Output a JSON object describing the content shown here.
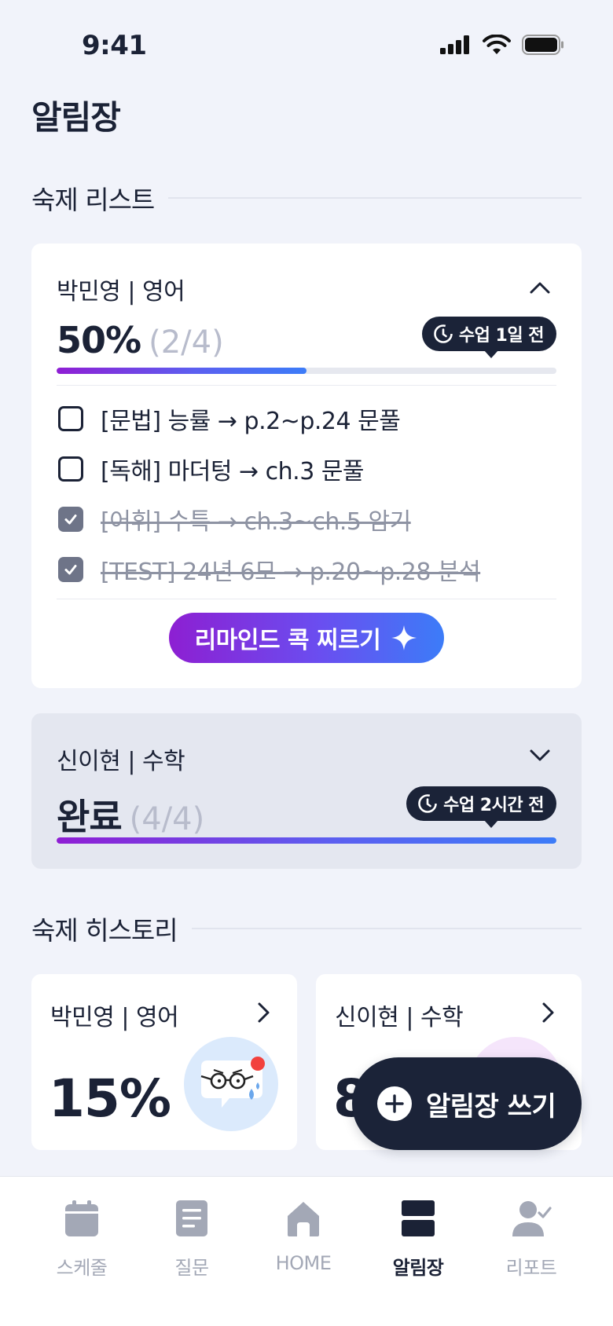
{
  "status_bar": {
    "time": "9:41"
  },
  "page_title": "알림장",
  "homework_list": {
    "section_label": "숙제 리스트",
    "cards": [
      {
        "title": "박민영 | 영어",
        "progress_main": "50%",
        "progress_sub": "(2/4)",
        "progress_fraction": 0.5,
        "tooltip": "수업 1일 전",
        "expanded": true,
        "tasks": [
          {
            "text": "[문법] 능률 → p.2~p.24 문풀",
            "done": false
          },
          {
            "text": "[독해] 마더텅 → ch.3 문풀",
            "done": false
          },
          {
            "text": "[어휘] 수특 → ch.3~ch.5 암기",
            "done": true
          },
          {
            "text": "[TEST] 24년 6모 → p.20~p.28 분석",
            "done": true
          }
        ],
        "remind_button": "리마인드 콕 찌르기"
      },
      {
        "title": "신이현 | 수학",
        "progress_main": "완료",
        "progress_sub": "(4/4)",
        "progress_fraction": 1.0,
        "tooltip": "수업 2시간 전",
        "expanded": false
      }
    ]
  },
  "homework_history": {
    "section_label": "숙제 히스토리",
    "cards": [
      {
        "title": "박민영 | 영어",
        "percent": "15%"
      },
      {
        "title": "신이현 | 수학",
        "percent": "8"
      }
    ]
  },
  "fab": {
    "label": "알림장 쓰기"
  },
  "tab_bar": {
    "items": [
      {
        "label": "스케줄",
        "icon": "calendar-icon",
        "active": false
      },
      {
        "label": "질문",
        "icon": "document-icon",
        "active": false
      },
      {
        "label": "HOME",
        "icon": "home-icon",
        "active": false
      },
      {
        "label": "알림장",
        "icon": "notice-board-icon",
        "active": true
      },
      {
        "label": "리포트",
        "icon": "person-check-icon",
        "active": false
      }
    ]
  },
  "colors": {
    "background": "#f1f3fa",
    "text_dark": "#1b2236",
    "gradient_start": "#8f1ed4",
    "gradient_end": "#3c7cf8",
    "tooltip_bg": "#1b2338"
  }
}
